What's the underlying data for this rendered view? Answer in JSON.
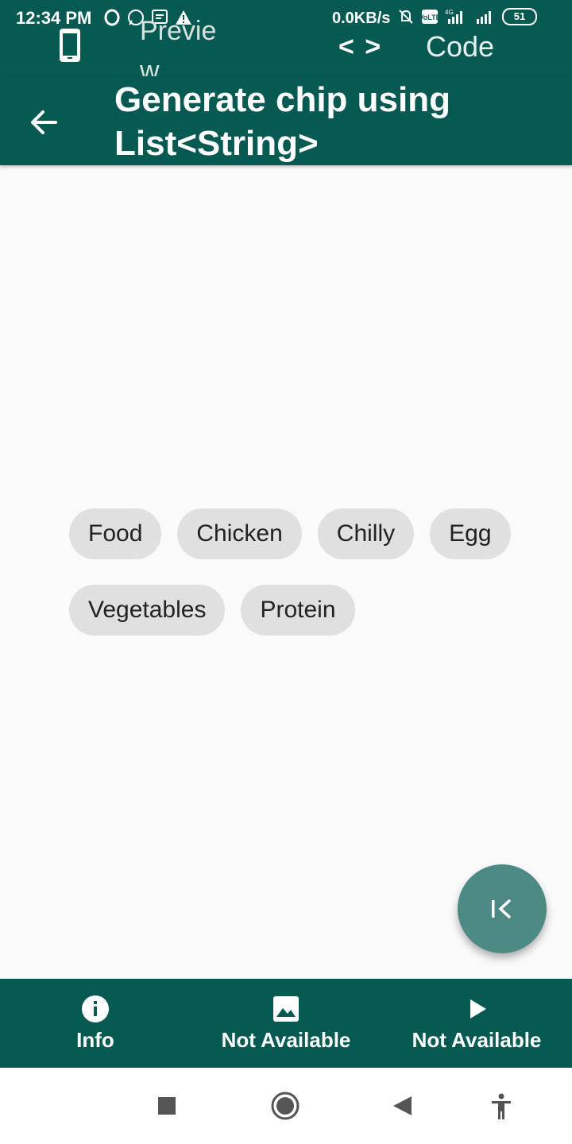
{
  "status_bar": {
    "time": "12:34 PM",
    "speed": "0.0KB/s",
    "battery": "51",
    "icons": [
      "opera-icon",
      "whatsapp-icon",
      "message-icon",
      "warning-icon",
      "mute-icon",
      "volte-icon",
      "signal-icon",
      "signal-icon"
    ]
  },
  "top_tabs": {
    "preview_label": "Preview",
    "code_label": "Code"
  },
  "app_bar": {
    "title": "Generate chip using List<String>"
  },
  "chips": [
    "Food",
    "Chicken",
    "Chilly",
    "Egg",
    "Vegetables",
    "Protein"
  ],
  "bottom_nav": {
    "items": [
      {
        "label": "Info",
        "icon": "info-icon"
      },
      {
        "label": "Not Available",
        "icon": "image-icon"
      },
      {
        "label": "Not Available",
        "icon": "play-icon"
      }
    ]
  },
  "colors": {
    "primary": "#075a52",
    "fab": "#4d8a84",
    "chip": "#e0e0e0",
    "background": "#fafafa"
  }
}
